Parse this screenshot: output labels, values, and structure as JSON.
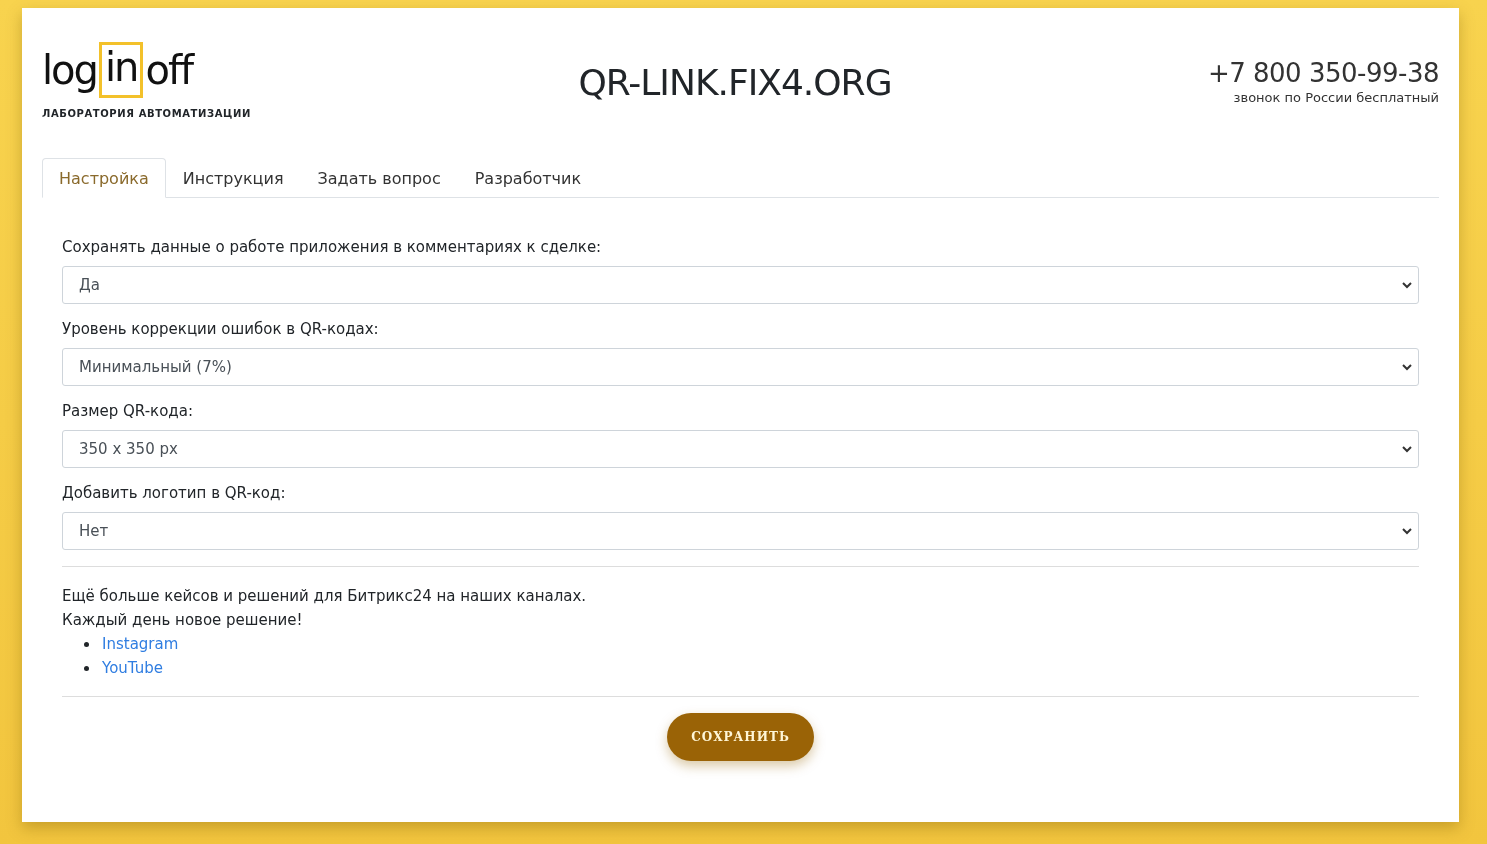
{
  "logo": {
    "parts": [
      "log",
      "in",
      "off"
    ],
    "subtitle": "ЛАБОРАТОРИЯ АВТОМАТИЗАЦИИ"
  },
  "site_title": "QR-LINK.FIX4.ORG",
  "contact": {
    "phone": "+7 800 350-99-38",
    "note": "звонок по России бесплатный"
  },
  "tabs": [
    {
      "label": "Настройка",
      "selected": true
    },
    {
      "label": "Инструкция",
      "selected": false
    },
    {
      "label": "Задать вопрос",
      "selected": false
    },
    {
      "label": "Разработчик",
      "selected": false
    }
  ],
  "settings": [
    {
      "label": "Сохранять данные о работе приложения в комментариях к сделке:",
      "value": "Да"
    },
    {
      "label": "Уровень коррекции ошибок в QR-кодах:",
      "value": "Минимальный (7%)"
    },
    {
      "label": "Размер QR-кода:",
      "value": "350 x 350 px"
    },
    {
      "label": "Добавить логотип в QR-код:",
      "value": "Нет"
    }
  ],
  "promo": {
    "lines": [
      "Ещё больше кейсов и решений для Битрикс24 на наших каналах.",
      "Каждый день новое решение!"
    ],
    "links": [
      "Instagram",
      "YouTube"
    ]
  },
  "save_button": "СОХРАНИТЬ"
}
